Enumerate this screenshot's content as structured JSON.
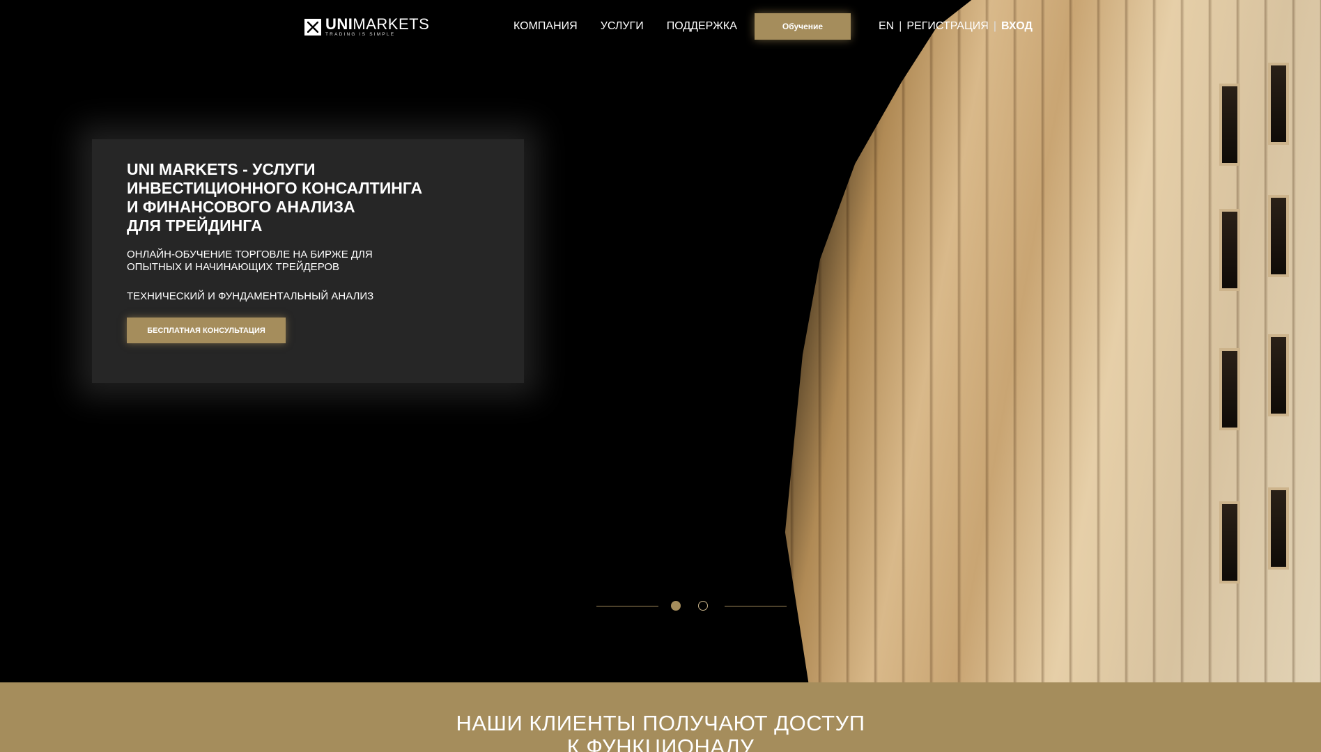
{
  "nav": {
    "logo_bold": "UNI",
    "logo_light": "MARKETS",
    "logo_tagline": "TRADING IS SIMPLE",
    "menu": [
      "КОМПАНИЯ",
      "УСЛУГИ",
      "ПОДДЕРЖКА"
    ],
    "learn_button": "Обучение",
    "lang": "EN",
    "register": "РЕГИСТРАЦИЯ",
    "login": "ВХОД"
  },
  "hero": {
    "title": "UNI MARKETS - УСЛУГИ\nИНВЕСТИЦИОННОГО КОНСАЛТИНГА\nИ ФИНАНСОВОГО АНАЛИЗА\nДЛЯ ТРЕЙДИНГА",
    "subtitle": "ОНЛАЙН-ОБУЧЕНИЕ ТОРГОВЛЕ НА БИРЖЕ ДЛЯ\nОПЫТНЫХ И НАЧИНАЮЩИХ ТРЕЙДЕРОВ",
    "subtitle2": "ТЕХНИЧЕСКИЙ И ФУНДАМЕНТАЛЬНЫЙ АНАЛИЗ",
    "cta": "БЕСПЛАТНАЯ КОНСУЛЬТАЦИЯ"
  },
  "slider": {
    "slides": 2,
    "active": 1
  },
  "band": {
    "heading": "НАШИ КЛИЕНТЫ ПОЛУЧАЮТ ДОСТУП\nК ФУНКЦИОНАЛУ"
  },
  "colors": {
    "accent": "#a58d5c",
    "background": "#000000",
    "promo_panel": "#262626"
  },
  "icons": {
    "logo": "unimarkets-logo-icon"
  }
}
